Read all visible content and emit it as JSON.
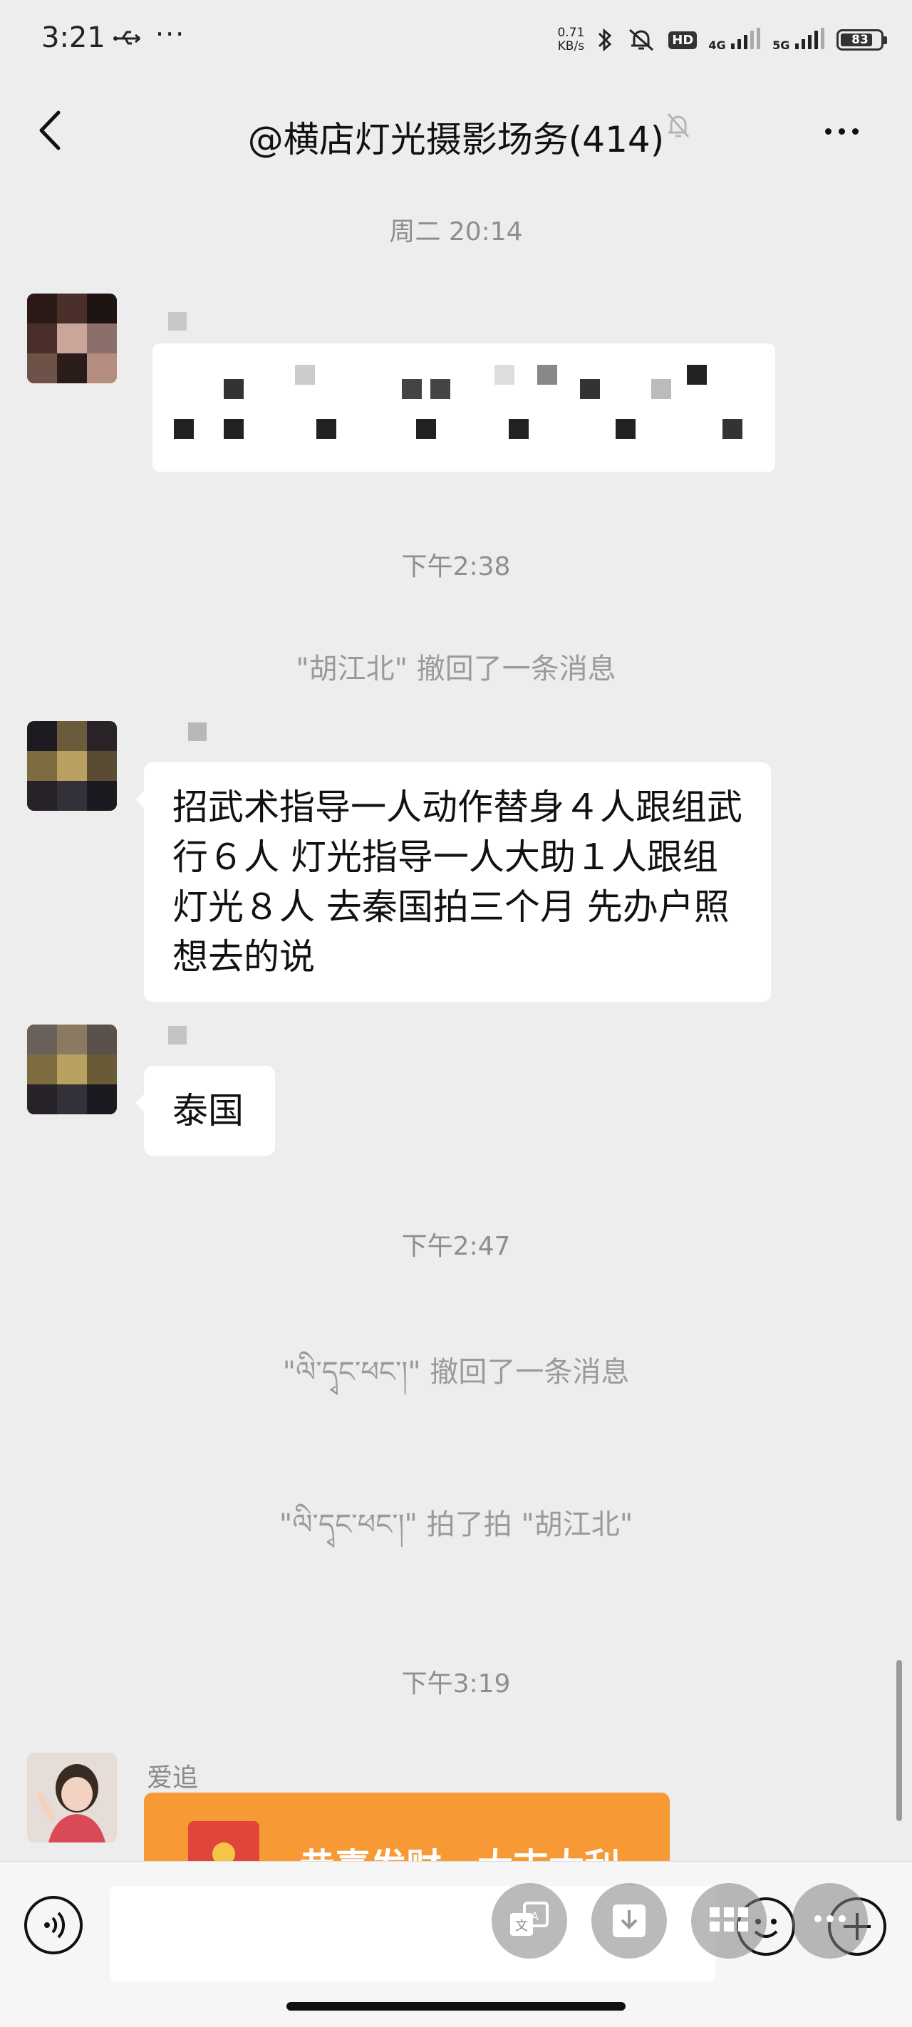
{
  "status_bar": {
    "time": "3:21",
    "net_speed_value": "0.71",
    "net_speed_unit": "KB/s",
    "hd_label": "HD",
    "net_4g": "4G",
    "net_5g": "5G",
    "battery": "83",
    "battery_level": 0.83
  },
  "header": {
    "title": "@横店灯光摄影场务(414)"
  },
  "messages": {
    "ts1": "周二 20:14",
    "ts2": "下午2:38",
    "sys1": "\"胡江北\" 撤回了一条消息",
    "msg2": "招武术指导一人动作替身４人跟组武行６人 灯光指导一人大助１人跟组灯光８人   去秦国拍三个月 先办户照    想去的说",
    "msg3": "泰国",
    "ts3": "下午2:47",
    "sys2": "\"ལི་དྭང་ཕང་།\" 撤回了一条消息",
    "sys3": "\"ལི་དྭང་ཕང་།\" 拍了拍 \"胡江北\"",
    "ts4": "下午3:19",
    "nick4": "爱追",
    "redpacket_text": "恭喜发财，大吉大利"
  },
  "colors": {
    "background": "#ededed",
    "bubble": "#ffffff",
    "redpacket": "#f79a35"
  }
}
